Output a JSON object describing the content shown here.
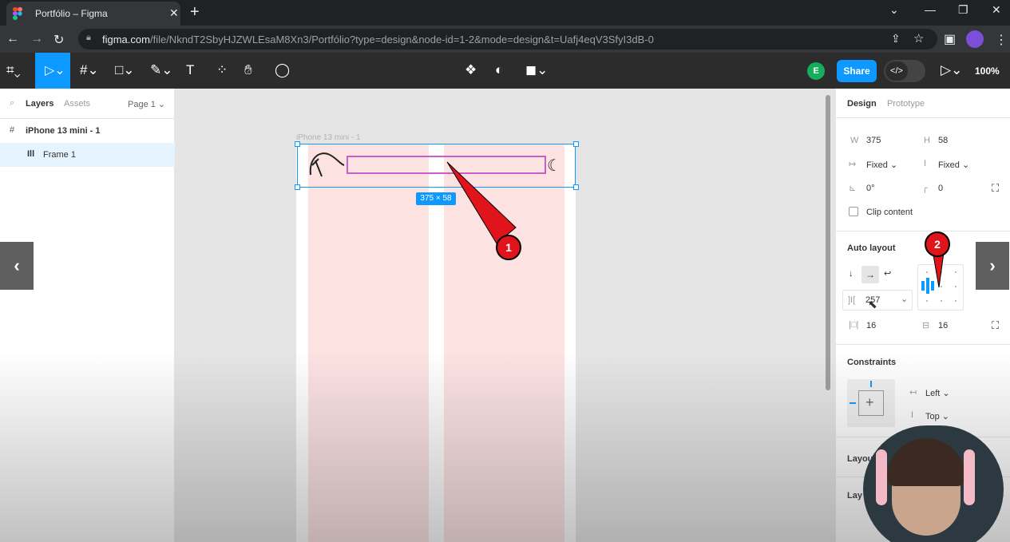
{
  "browser": {
    "tab_title": "Portfólio – Figma",
    "url_domain": "figma.com",
    "url_path": "/file/NkndT2SbyHJZWLEsaM8Xn3/Portfólio?type=design&node-id=1-2&mode=design&t=Uafj4eqV3SfyI3dB-0"
  },
  "toolbar": {
    "avatar_initial": "E",
    "share_label": "Share",
    "zoom_label": "100%",
    "accent_color": "#0d99ff"
  },
  "layers_panel": {
    "tabs": [
      "Layers",
      "Assets"
    ],
    "page_label": "Page 1",
    "layers": [
      "iPhone 13 mini - 1",
      "Frame 1"
    ]
  },
  "canvas": {
    "frame_label": "iPhone 13 mini - 1",
    "size_badge": "375 × 58"
  },
  "design_panel": {
    "tabs": [
      "Design",
      "Prototype"
    ],
    "w_label": "W",
    "w_value": "375",
    "h_label": "H",
    "h_value": "58",
    "h_sizing": "Fixed",
    "v_sizing": "Fixed",
    "rotation": "0°",
    "radius": "0",
    "clip_content": "Clip content",
    "auto_layout_title": "Auto layout",
    "gap_value": "257",
    "padding_h": "16",
    "padding_v": "16",
    "constraints_title": "Constraints",
    "constraint_h": "Left",
    "constraint_v": "Top",
    "layout_grid_title": "Layou",
    "layer_title": "Lay"
  },
  "annotations": {
    "callout_1": "1",
    "callout_2": "2"
  }
}
